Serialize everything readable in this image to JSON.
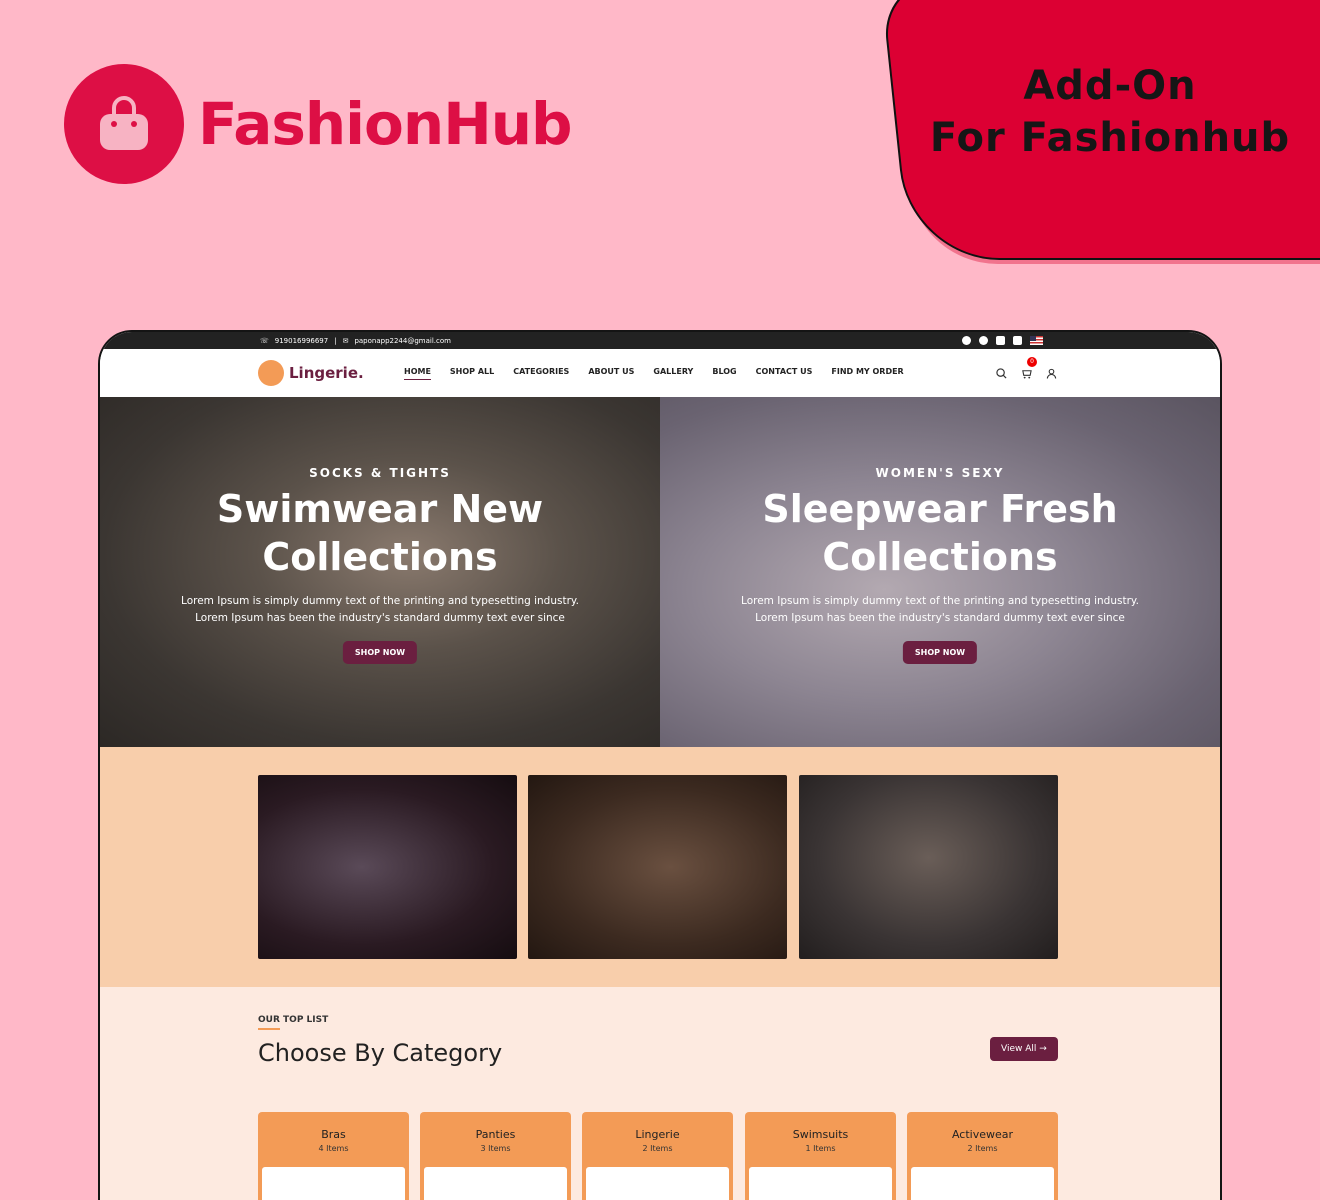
{
  "logo": {
    "text": "FashionHub"
  },
  "badge": {
    "line1": "Add-On",
    "line2": "For Fashionhub"
  },
  "topbar": {
    "phone": "919016996697",
    "email": "paponapp2244@gmail.com",
    "social_icons": [
      "facebook-icon",
      "twitter-icon",
      "instagram-icon",
      "linkedin-icon",
      "us-flag-icon"
    ]
  },
  "nav": {
    "brand": "Lingerie.",
    "menu": [
      {
        "label": "HOME",
        "active": true
      },
      {
        "label": "SHOP ALL"
      },
      {
        "label": "CATEGORIES"
      },
      {
        "label": "ABOUT US"
      },
      {
        "label": "GALLERY"
      },
      {
        "label": "BLOG"
      },
      {
        "label": "CONTACT US"
      },
      {
        "label": "FIND MY ORDER"
      }
    ],
    "cart_count": "0"
  },
  "hero": [
    {
      "subtitle": "SOCKS & TIGHTS",
      "title_line1": "Swimwear New",
      "title_line2": "Collections",
      "desc_line1": "Lorem Ipsum is simply dummy text of the printing and typesetting industry.",
      "desc_line2": "Lorem Ipsum has been the industry's standard dummy text ever since",
      "button": "SHOP NOW"
    },
    {
      "subtitle": "WOMEN'S SEXY",
      "title_line1": "Sleepwear Fresh",
      "title_line2": "Collections",
      "desc_line1": "Lorem Ipsum is simply dummy text of the printing and typesetting industry.",
      "desc_line2": "Lorem Ipsum has been the industry's standard dummy text ever since",
      "button": "SHOP NOW"
    }
  ],
  "categories": {
    "eyebrow": "OUR TOP LIST",
    "title": "Choose By Category",
    "view_all": "View All",
    "items": [
      {
        "name": "Bras",
        "count": "4 Items"
      },
      {
        "name": "Panties",
        "count": "3 Items"
      },
      {
        "name": "Lingerie",
        "count": "2 Items"
      },
      {
        "name": "Swimsuits",
        "count": "1 Items"
      },
      {
        "name": "Activewear",
        "count": "2 Items"
      }
    ]
  },
  "colors": {
    "brand": "#dd0f45",
    "badge": "#dc0033",
    "accent": "#6b1f40",
    "orange": "#f39b56",
    "page_bg": "#ffb8c8"
  }
}
